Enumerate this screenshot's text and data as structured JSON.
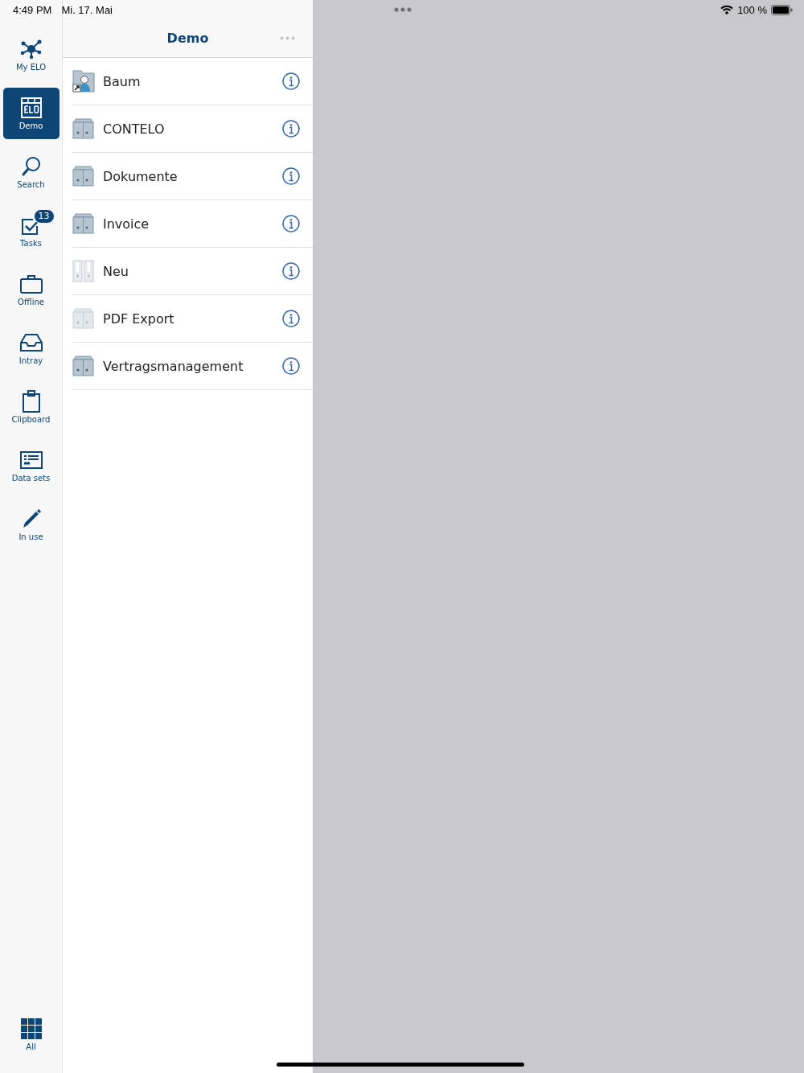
{
  "status_bar": {
    "time": "4:49 PM",
    "date": "Mi. 17. Mai",
    "battery": "100 %"
  },
  "sidebar": {
    "items": [
      {
        "kind": "network",
        "label": "My ELO",
        "selected": false
      },
      {
        "kind": "elo",
        "label": "Demo",
        "selected": true
      },
      {
        "kind": "search",
        "label": "Search",
        "selected": false
      },
      {
        "kind": "tasks",
        "label": "Tasks",
        "selected": false,
        "badge": "13"
      },
      {
        "kind": "briefcase",
        "label": "Offline",
        "selected": false
      },
      {
        "kind": "tray",
        "label": "Intray",
        "selected": false
      },
      {
        "kind": "clipboard",
        "label": "Clipboard",
        "selected": false
      },
      {
        "kind": "datasets",
        "label": "Data sets",
        "selected": false
      },
      {
        "kind": "pencil",
        "label": "In use",
        "selected": false
      }
    ],
    "bottom_item": {
      "kind": "grid",
      "label": "All",
      "selected": false
    }
  },
  "panel": {
    "title": "Demo",
    "items": [
      {
        "kind": "person-folder",
        "label": "Baum"
      },
      {
        "kind": "cabinet",
        "label": "CONTELO"
      },
      {
        "kind": "cabinet",
        "label": "Dokumente"
      },
      {
        "kind": "cabinet",
        "label": "Invoice"
      },
      {
        "kind": "binder",
        "label": "Neu"
      },
      {
        "kind": "cabinet-light",
        "label": "PDF Export"
      },
      {
        "kind": "cabinet",
        "label": "Vertragsmanagement"
      }
    ]
  }
}
